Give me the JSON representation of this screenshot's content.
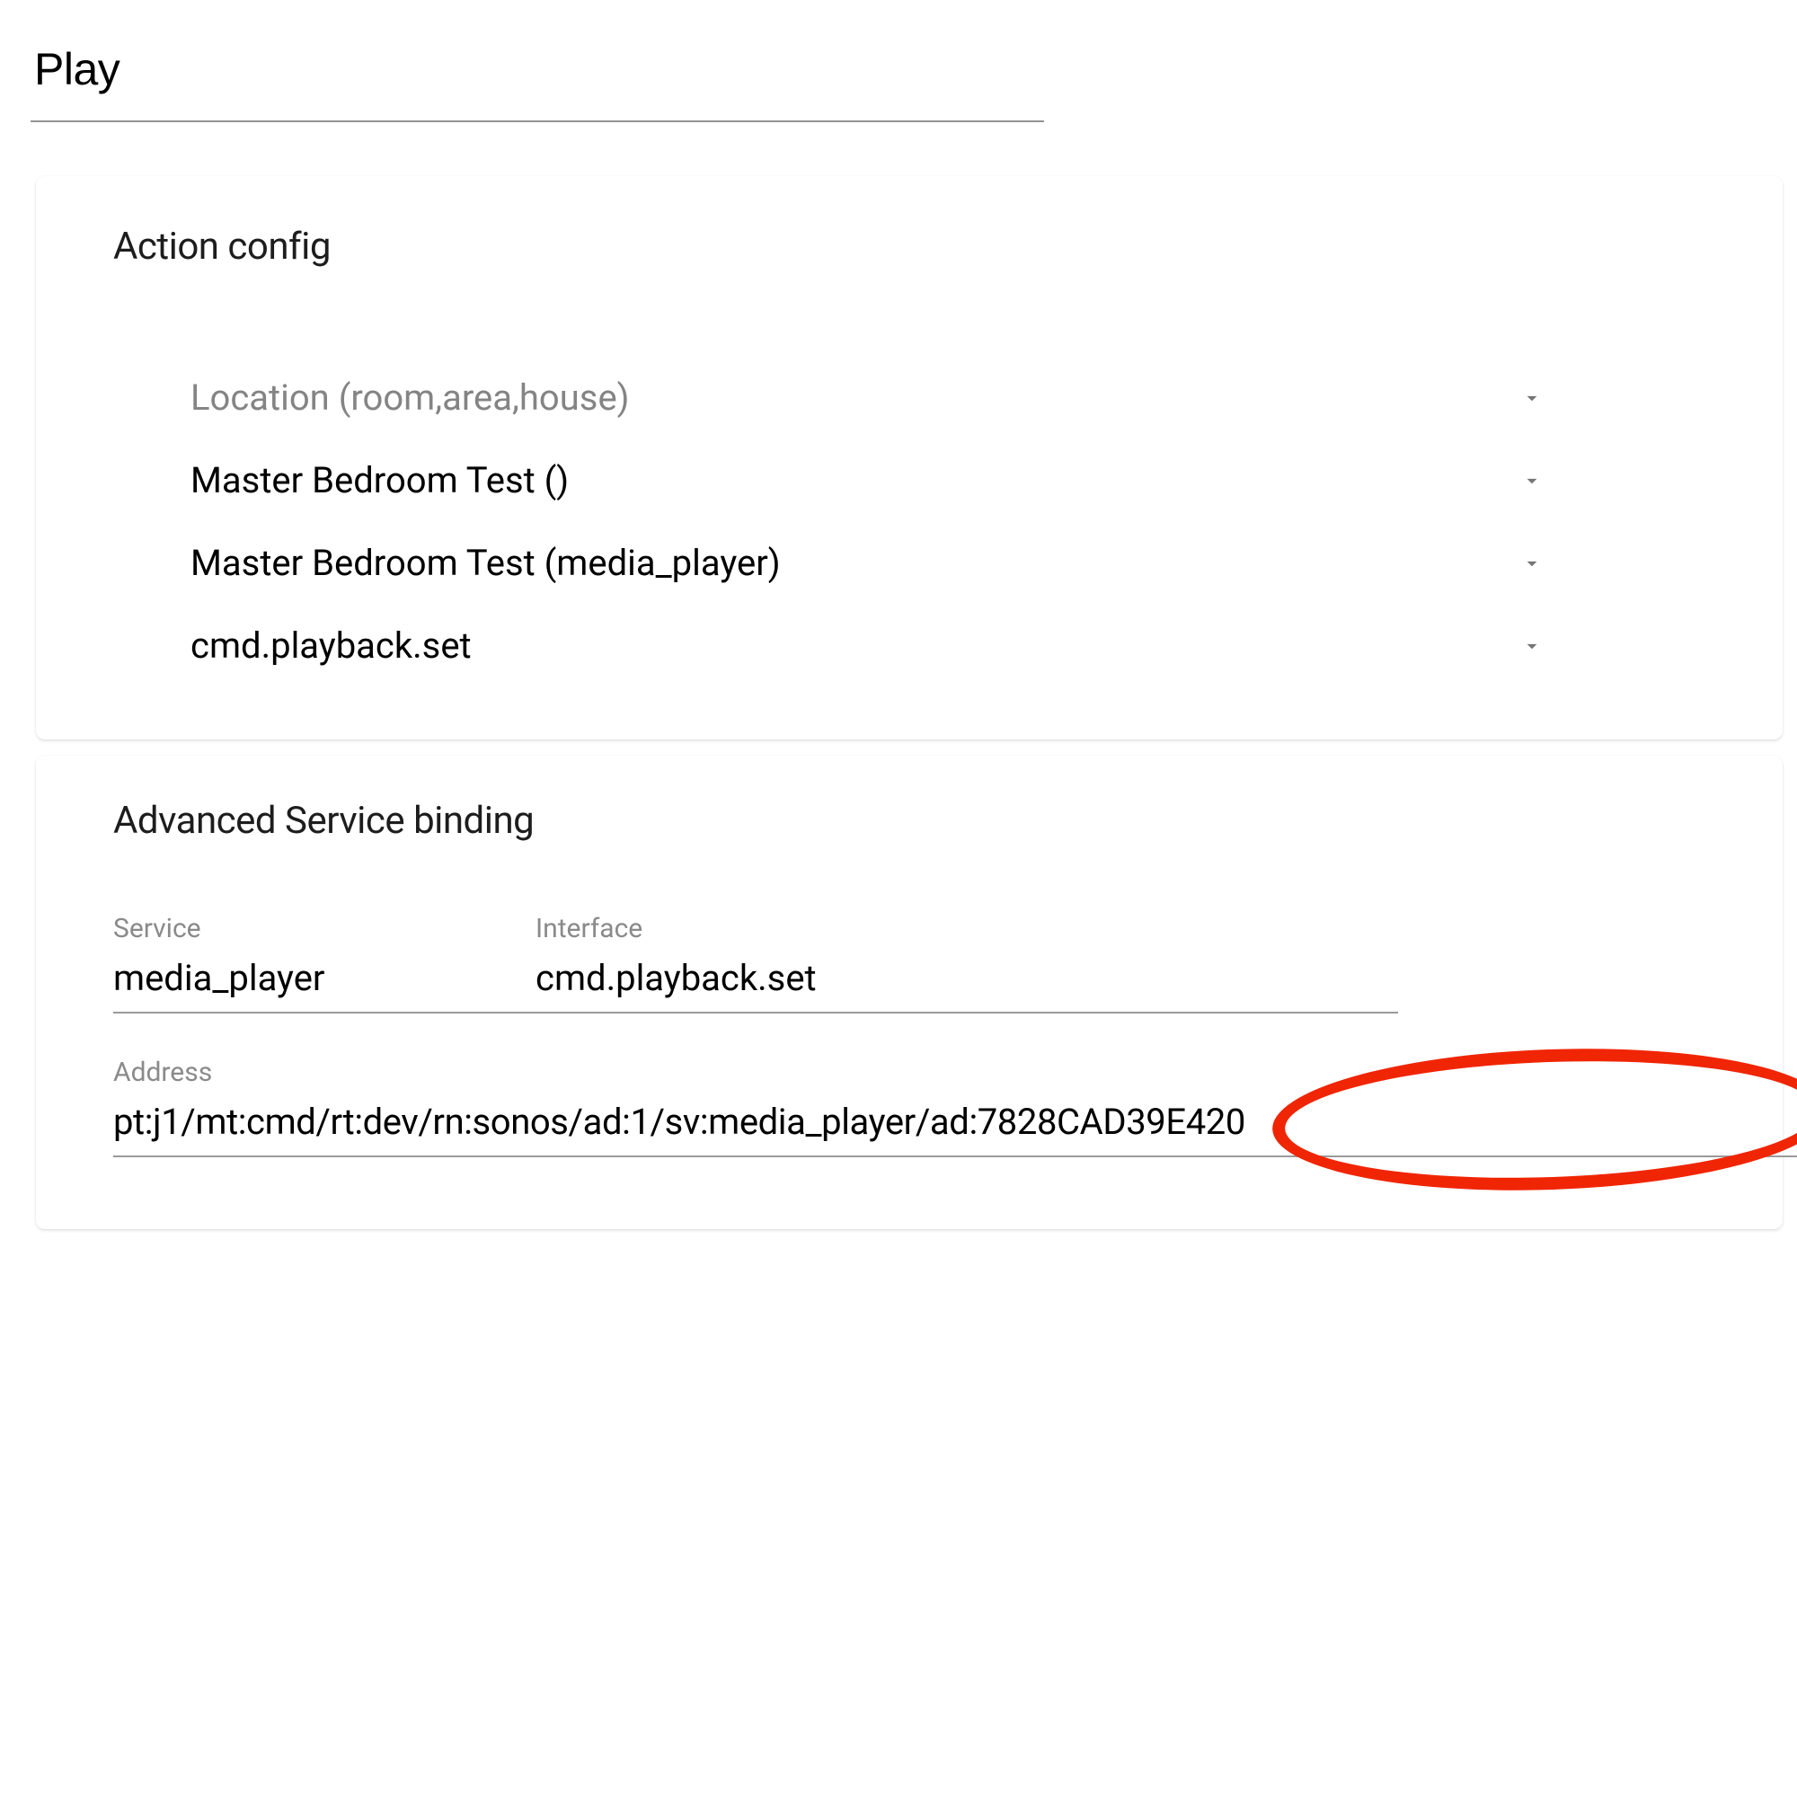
{
  "title_input": "Play",
  "action_config": {
    "heading": "Action config",
    "rows": [
      {
        "label": "Location (room,area,house)",
        "placeholder": true
      },
      {
        "label": "Master Bedroom Test ()",
        "placeholder": false
      },
      {
        "label": "Master Bedroom Test (media_player)",
        "placeholder": false
      },
      {
        "label": "cmd.playback.set",
        "placeholder": false
      }
    ]
  },
  "advanced_binding": {
    "heading": "Advanced Service binding",
    "service_label": "Service",
    "service_value": "media_player",
    "interface_label": "Interface",
    "interface_value": "cmd.playback.set",
    "address_label": "Address",
    "address_value": "pt:j1/mt:cmd/rt:dev/rn:sonos/ad:1/sv:media_player/ad:7828CAD39E420"
  }
}
